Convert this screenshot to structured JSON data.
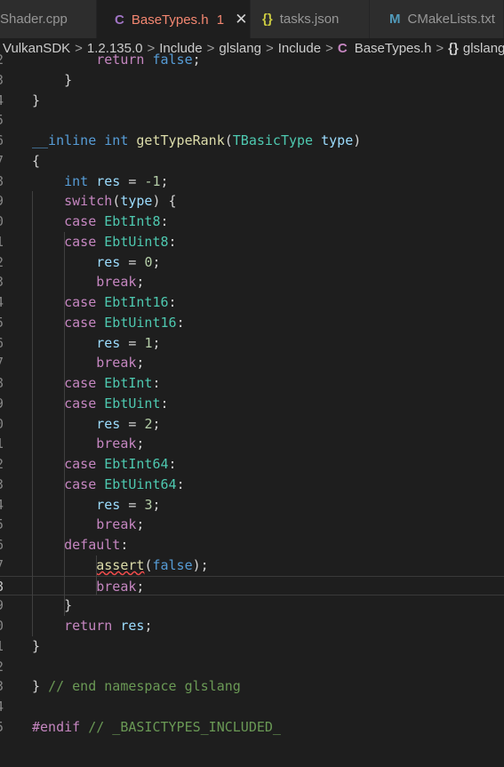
{
  "tabs": [
    {
      "label": "Shader.cpp",
      "icon": "",
      "active": false
    },
    {
      "label": "BaseTypes.h",
      "icon": "C",
      "badge": "1",
      "active": true
    },
    {
      "label": "tasks.json",
      "icon": "{}",
      "active": false
    },
    {
      "label": "CMakeLists.txt",
      "icon": "M",
      "active": false
    }
  ],
  "breadcrumb": [
    "VulkanSDK",
    "1.2.135.0",
    "Include",
    "glslang",
    "Include",
    "BaseTypes.h",
    "glslang"
  ],
  "breadcrumb_icons": {
    "file": "C",
    "namespace": "{}"
  },
  "colors": {
    "keyword": "#569cd6",
    "control": "#c586c0",
    "function": "#dcdcaa",
    "type": "#4ec9b0",
    "variable": "#9cdcfe",
    "number": "#b5cea8",
    "comment": "#6a9955",
    "error_tab": "#f48771"
  },
  "code_lines": [
    {
      "n": "2",
      "code": "        return false;"
    },
    {
      "n": "3",
      "code": "    }"
    },
    {
      "n": "4",
      "code": "}"
    },
    {
      "n": "5",
      "code": ""
    },
    {
      "n": "6",
      "code": "__inline int getTypeRank(TBasicType type)"
    },
    {
      "n": "7",
      "code": "{"
    },
    {
      "n": "8",
      "code": "    int res = -1;"
    },
    {
      "n": "9",
      "code": "    switch(type) {"
    },
    {
      "n": "0",
      "code": "    case EbtInt8:"
    },
    {
      "n": "1",
      "code": "    case EbtUint8:"
    },
    {
      "n": "2",
      "code": "        res = 0;"
    },
    {
      "n": "3",
      "code": "        break;"
    },
    {
      "n": "4",
      "code": "    case EbtInt16:"
    },
    {
      "n": "5",
      "code": "    case EbtUint16:"
    },
    {
      "n": "6",
      "code": "        res = 1;"
    },
    {
      "n": "7",
      "code": "        break;"
    },
    {
      "n": "8",
      "code": "    case EbtInt:"
    },
    {
      "n": "9",
      "code": "    case EbtUint:"
    },
    {
      "n": "0",
      "code": "        res = 2;"
    },
    {
      "n": "1",
      "code": "        break;"
    },
    {
      "n": "2",
      "code": "    case EbtInt64:"
    },
    {
      "n": "3",
      "code": "    case EbtUint64:"
    },
    {
      "n": "4",
      "code": "        res = 3;"
    },
    {
      "n": "5",
      "code": "        break;"
    },
    {
      "n": "6",
      "code": "    default:"
    },
    {
      "n": "7",
      "code": "        assert(false);"
    },
    {
      "n": "8",
      "code": "        break;",
      "current": true
    },
    {
      "n": "9",
      "code": "    }"
    },
    {
      "n": "0",
      "code": "    return res;"
    },
    {
      "n": "1",
      "code": "}"
    },
    {
      "n": "2",
      "code": ""
    },
    {
      "n": "3",
      "code": "} // end namespace glslang"
    },
    {
      "n": "4",
      "code": ""
    },
    {
      "n": "5",
      "code": "#endif // _BASICTYPES_INCLUDED_"
    }
  ]
}
